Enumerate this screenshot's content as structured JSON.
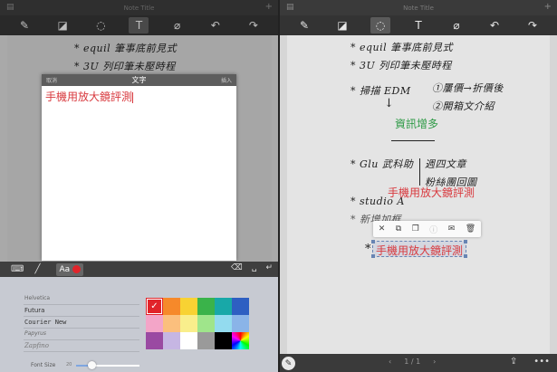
{
  "left": {
    "title": "Note Title",
    "toolbar": [
      "pen-icon",
      "eraser-icon",
      "lasso-icon",
      "text-icon",
      "attach-icon",
      "undo-icon",
      "redo-icon"
    ],
    "dialog": {
      "cancel": "取消",
      "title": "文字",
      "insert": "插入",
      "text": "手機用放大鏡評測"
    },
    "keyboard_bar": {
      "aa": "Aa",
      "color": "#e1242a"
    },
    "fonts": [
      "Helvetica",
      "Futura",
      "Courier New",
      "Papyrus",
      "Zapfino"
    ],
    "palette": [
      "#e1242a",
      "#f6892a",
      "#f8d233",
      "#3ab34a",
      "#18a8a8",
      "#2e5fc2",
      "#f3a5c8",
      "#fbbf7d",
      "#f9ee8c",
      "#9fe58b",
      "#93dbef",
      "#8ab4e8",
      "#9a4aa2",
      "#c6b6e3",
      "#ffffff",
      "#9a9a9a",
      "#000000",
      "spectrum"
    ],
    "font_size_label": "Font Size",
    "font_size_value": "20",
    "font_size_fraction": 0.24
  },
  "right": {
    "title": "Note Title",
    "handwriting": [
      "* equil 筆事底前見式",
      "* 3U 列印筆未壓時程",
      "* 掃描 EDM",
      "①屢價→折價後",
      "②開箱文介紹",
      "* Glu 武科助",
      "週四文章",
      "粉絲團回圖",
      "* studio A",
      "* 新增加框",
      "*"
    ],
    "green_text": "資訊增多",
    "red_text": "手機用放大鏡評測",
    "selected_text": "手機用放大鏡評測",
    "context_menu": [
      "close-icon",
      "copy-icon",
      "duplicate-icon",
      "info-icon",
      "mail-icon",
      "trash-icon"
    ],
    "pager": {
      "prev": "‹",
      "page": "1 / 1",
      "next": "›"
    }
  }
}
